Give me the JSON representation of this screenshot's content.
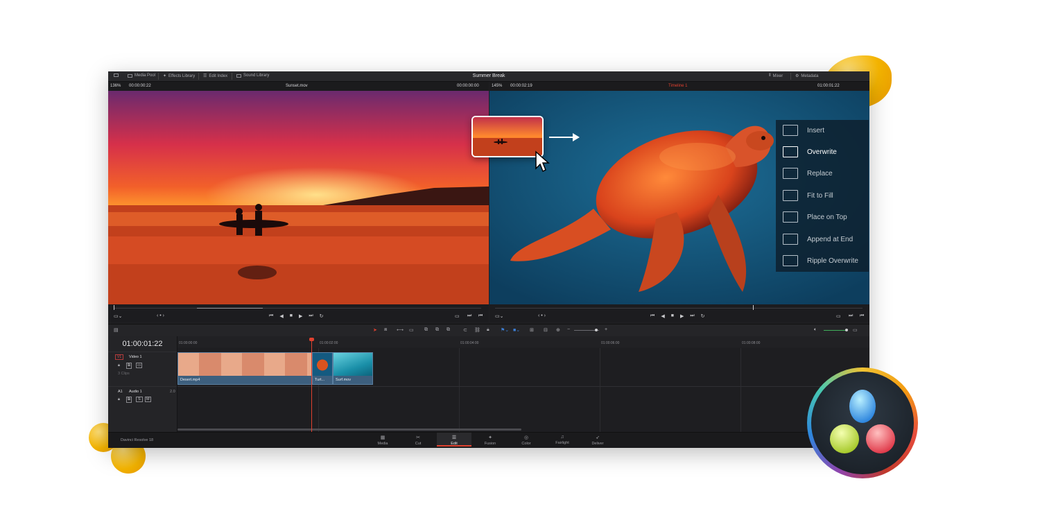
{
  "toolbar": {
    "media_pool": "Media Pool",
    "effects_library": "Effects Library",
    "edit_index": "Edit Index",
    "sound_library": "Sound Library",
    "project_title": "Summer Break",
    "mixer": "Mixer",
    "metadata": "Metadata"
  },
  "source_viewer": {
    "zoom": "136%",
    "timecode": "00:00:00:22",
    "clip_name": "Sunset.mov",
    "duration": "00:00:00:00"
  },
  "timeline_viewer": {
    "zoom": "145%",
    "timecode": "00:00:02:19",
    "timeline_name": "Timeline 1",
    "duration": "01:00:01:22"
  },
  "overlay_menu": {
    "items": [
      "Insert",
      "Overwrite",
      "Replace",
      "Fit to Fill",
      "Place on Top",
      "Append at End",
      "Ripple Overwrite"
    ],
    "highlighted": "Overwrite"
  },
  "timeline": {
    "current_timecode": "01:00:01:22",
    "ruler": [
      "01:00:00:00",
      "01:00:02:00",
      "01:00:04:00",
      "01:00:06:00",
      "01:00:08:00"
    ],
    "video_track": {
      "tag": "V1",
      "name": "Video 1",
      "clips_count": "3 Clips"
    },
    "audio_track": {
      "tag": "A1",
      "name": "Audio 1",
      "level": "2.0"
    },
    "clips": [
      {
        "name": "Desert.mp4"
      },
      {
        "name": "Turt..."
      },
      {
        "name": "Surf.mov"
      }
    ]
  },
  "footer": {
    "app_name": "Davinci Resolve 18",
    "pages": [
      "Media",
      "Cut",
      "Edit",
      "Fusion",
      "Color",
      "Fairlight",
      "Deliver"
    ],
    "active_page": "Edit"
  },
  "colors": {
    "accent_red": "#e0412f",
    "clip_blue": "#3d5f7e",
    "panel_bg": "#1f1f22"
  }
}
